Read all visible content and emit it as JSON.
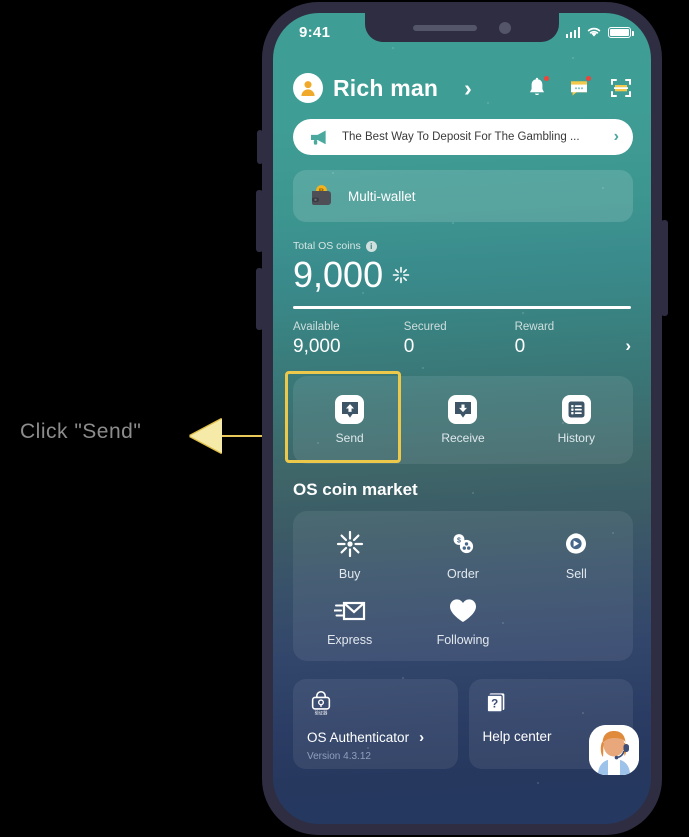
{
  "annotation": {
    "text": "Click \"Send\"",
    "arrow_color": "#ecc94b",
    "highlight_color": "#ecc94b"
  },
  "status_bar": {
    "time": "9:41",
    "signal": "signal-bars",
    "wifi": "wifi",
    "battery": "battery-full"
  },
  "header": {
    "username": "Rich man",
    "avatar_icon": "user-avatar-icon",
    "chevron": "›",
    "icons": [
      {
        "name": "bell-icon",
        "badge": true
      },
      {
        "name": "message-icon",
        "badge": true
      },
      {
        "name": "scan-icon",
        "badge": false
      }
    ]
  },
  "banner": {
    "icon": "megaphone-icon",
    "text": "The Best Way To Deposit For The Gambling ...",
    "chevron": "›"
  },
  "wallet": {
    "icon": "wallet-bitcoin-icon",
    "label": "Multi-wallet"
  },
  "balance": {
    "label": "Total OS coins",
    "info_icon": "info-icon",
    "amount": "9,000",
    "coin_icon": "os-coin-sparkle-icon",
    "stats": [
      {
        "label": "Available",
        "value": "9,000"
      },
      {
        "label": "Secured",
        "value": "0"
      },
      {
        "label": "Reward",
        "value": "0"
      }
    ],
    "chevron": "›"
  },
  "actions": [
    {
      "label": "Send",
      "icon": "send-up-arrow-icon",
      "highlighted": true
    },
    {
      "label": "Receive",
      "icon": "receive-down-arrow-icon",
      "highlighted": false
    },
    {
      "label": "History",
      "icon": "list-history-icon",
      "highlighted": false
    }
  ],
  "market": {
    "title": "OS coin market",
    "items": [
      {
        "label": "Buy",
        "icon": "buy-sparkle-icon"
      },
      {
        "label": "Order",
        "icon": "order-coins-icon"
      },
      {
        "label": "Sell",
        "icon": "sell-coin-icon"
      },
      {
        "label": "Express",
        "icon": "express-envelope-icon"
      },
      {
        "label": "Following",
        "icon": "heart-icon"
      }
    ]
  },
  "bottom_cards": [
    {
      "title": "OS Authenticator",
      "icon": "authenticator-safe-icon",
      "icon_caption": "验证器",
      "chevron": "›",
      "version": "Version 4.3.12"
    },
    {
      "title": "Help center",
      "icon": "help-question-icon",
      "agent_avatar": "support-agent-avatar"
    }
  ]
}
